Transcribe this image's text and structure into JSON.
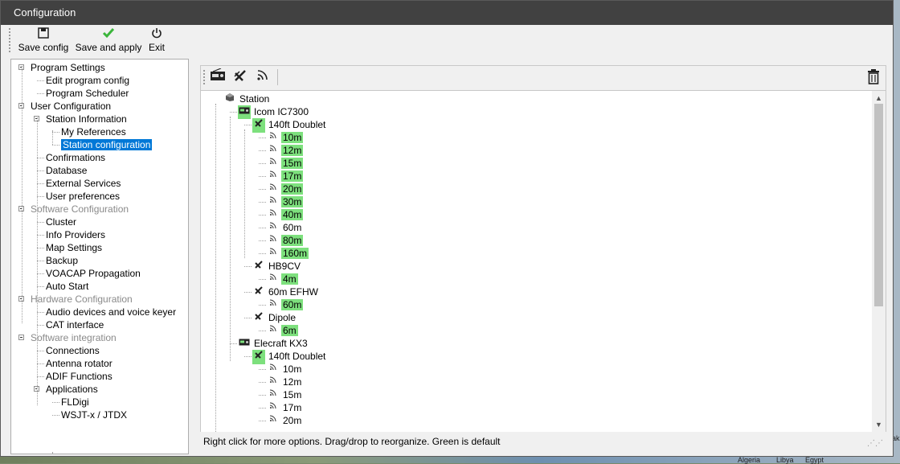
{
  "window": {
    "title": "Configuration"
  },
  "toolbar": {
    "save_config": "Save config",
    "save_apply": "Save and apply",
    "exit": "Exit"
  },
  "nav": [
    {
      "label": "Program Settings",
      "level": 0,
      "gray": false,
      "expander": true
    },
    {
      "label": "Edit program config",
      "level": 1,
      "gray": false
    },
    {
      "label": "Program Scheduler",
      "level": 1,
      "gray": false
    },
    {
      "label": "User Configuration",
      "level": 0,
      "gray": false,
      "expander": true
    },
    {
      "label": "Station Information",
      "level": 1,
      "gray": false,
      "expander": true
    },
    {
      "label": "My References",
      "level": 2,
      "gray": false
    },
    {
      "label": "Station configuration",
      "level": 2,
      "gray": false,
      "selected": true
    },
    {
      "label": "Confirmations",
      "level": 1,
      "gray": false
    },
    {
      "label": "Database",
      "level": 1,
      "gray": false
    },
    {
      "label": "External Services",
      "level": 1,
      "gray": false
    },
    {
      "label": "User preferences",
      "level": 1,
      "gray": false
    },
    {
      "label": "Software Configuration",
      "level": 0,
      "gray": true,
      "expander": true
    },
    {
      "label": "Cluster",
      "level": 1,
      "gray": false
    },
    {
      "label": "Info Providers",
      "level": 1,
      "gray": false
    },
    {
      "label": "Map Settings",
      "level": 1,
      "gray": false
    },
    {
      "label": "Backup",
      "level": 1,
      "gray": false
    },
    {
      "label": "VOACAP Propagation",
      "level": 1,
      "gray": false
    },
    {
      "label": "Auto Start",
      "level": 1,
      "gray": false
    },
    {
      "label": "Hardware Configuration",
      "level": 0,
      "gray": true,
      "expander": true
    },
    {
      "label": "Audio devices and voice keyer",
      "level": 1,
      "gray": false
    },
    {
      "label": "CAT interface",
      "level": 1,
      "gray": false
    },
    {
      "label": "Software integration",
      "level": 0,
      "gray": true,
      "expander": true
    },
    {
      "label": "Connections",
      "level": 1,
      "gray": false
    },
    {
      "label": "Antenna rotator",
      "level": 1,
      "gray": false
    },
    {
      "label": "ADIF Functions",
      "level": 1,
      "gray": false
    },
    {
      "label": "Applications",
      "level": 1,
      "gray": false,
      "expander": true
    },
    {
      "label": "FLDigi",
      "level": 2,
      "gray": false
    },
    {
      "label": "WSJT-x / JTDX",
      "level": 2,
      "gray": false
    }
  ],
  "station_tree": [
    {
      "label": "Station",
      "kind": "station",
      "level": 0
    },
    {
      "label": "Icom IC7300",
      "kind": "radio",
      "level": 1,
      "default": true
    },
    {
      "label": "140ft Doublet",
      "kind": "antenna",
      "level": 2,
      "default": true
    },
    {
      "label": "10m",
      "kind": "band",
      "level": 3,
      "default": true
    },
    {
      "label": "12m",
      "kind": "band",
      "level": 3,
      "default": true
    },
    {
      "label": "15m",
      "kind": "band",
      "level": 3,
      "default": true
    },
    {
      "label": "17m",
      "kind": "band",
      "level": 3,
      "default": true
    },
    {
      "label": "20m",
      "kind": "band",
      "level": 3,
      "default": true
    },
    {
      "label": "30m",
      "kind": "band",
      "level": 3,
      "default": true
    },
    {
      "label": "40m",
      "kind": "band",
      "level": 3,
      "default": true
    },
    {
      "label": "60m",
      "kind": "band",
      "level": 3,
      "default": false
    },
    {
      "label": "80m",
      "kind": "band",
      "level": 3,
      "default": true
    },
    {
      "label": "160m",
      "kind": "band",
      "level": 3,
      "default": true
    },
    {
      "label": "HB9CV",
      "kind": "antenna",
      "level": 2,
      "default": false
    },
    {
      "label": "4m",
      "kind": "band",
      "level": 3,
      "default": true
    },
    {
      "label": "60m EFHW",
      "kind": "antenna",
      "level": 2,
      "default": false
    },
    {
      "label": "60m",
      "kind": "band",
      "level": 3,
      "default": true
    },
    {
      "label": "Dipole",
      "kind": "antenna",
      "level": 2,
      "default": false
    },
    {
      "label": "6m",
      "kind": "band",
      "level": 3,
      "default": true
    },
    {
      "label": "Elecraft KX3",
      "kind": "radio",
      "level": 1,
      "default": false
    },
    {
      "label": "140ft Doublet",
      "kind": "antenna",
      "level": 2,
      "default": true
    },
    {
      "label": "10m",
      "kind": "band",
      "level": 3,
      "default": false
    },
    {
      "label": "12m",
      "kind": "band",
      "level": 3,
      "default": false
    },
    {
      "label": "15m",
      "kind": "band",
      "level": 3,
      "default": false
    },
    {
      "label": "17m",
      "kind": "band",
      "level": 3,
      "default": false
    },
    {
      "label": "20m",
      "kind": "band",
      "level": 3,
      "default": false
    }
  ],
  "status": "Right click for more options. Drag/drop to reorganize. Green is default",
  "map_labels": [
    "Algeria",
    "Libya",
    "Egypt",
    "Pak"
  ],
  "colors": {
    "default_green": "#7de07d",
    "selection": "#0078d7",
    "titlebar": "#414141"
  }
}
